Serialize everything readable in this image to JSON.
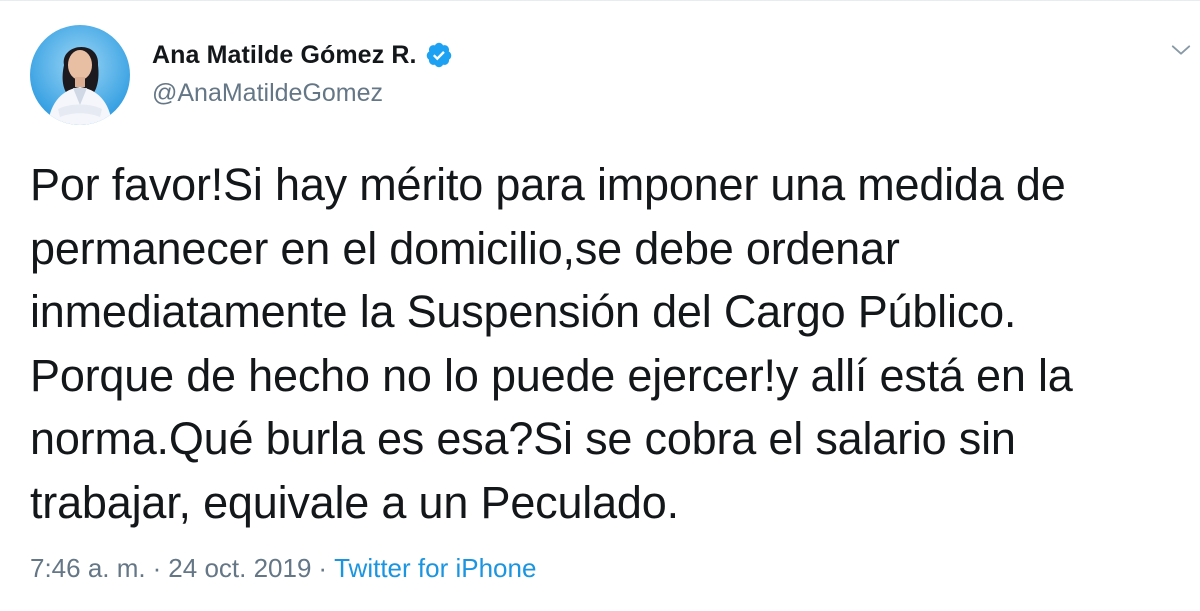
{
  "author": {
    "name": "Ana Matilde Gómez R.",
    "handle": "@AnaMatildeGomez",
    "verified": true,
    "avatar_bg": "#3aa2e3"
  },
  "tweet": {
    "text": "Por favor!Si hay mérito para imponer una medida de\npermanecer en el domicilio,se debe ordenar\ninmediatamente la Suspensión del Cargo Público.\nPorque de hecho no lo puede ejercer!y allí está en la\nnorma.Qué burla es esa?Si se cobra el salario sin\ntrabajar, equivale a un Peculado.",
    "time": "7:46 a. m.",
    "separator": "·",
    "date": "24 oct. 2019",
    "source": "Twitter for iPhone"
  },
  "colors": {
    "text": "#14171a",
    "secondary": "#657786",
    "link": "#1b95e0",
    "verified_badge": "#1da1f2"
  },
  "icons": {
    "verified": "verified-badge-icon",
    "menu": "chevron-down-icon"
  }
}
